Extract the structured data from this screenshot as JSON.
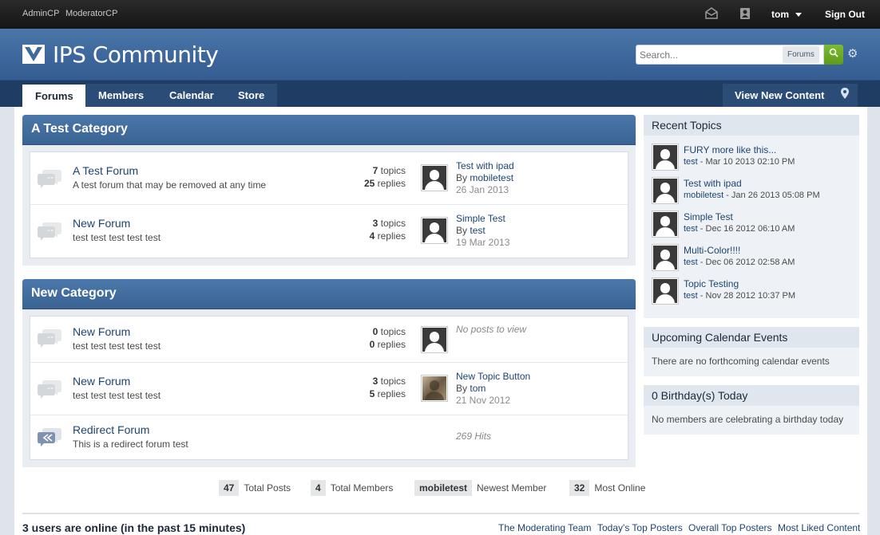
{
  "topbar": {
    "links": [
      "AdminCP",
      "ModeratorCP"
    ],
    "icons": [
      "envelope-icon",
      "contact-card-icon"
    ],
    "user": "tom",
    "signout": "Sign Out"
  },
  "header": {
    "title": "IPS Community",
    "search_placeholder": "Search...",
    "search_scope": "Forums"
  },
  "nav": {
    "tabs": [
      "Forums",
      "Members",
      "Calendar",
      "Store"
    ],
    "view_new": "View New Content"
  },
  "categories": [
    {
      "title": "A Test Category",
      "forums": [
        {
          "name": "A Test Forum",
          "desc": "A test forum that may be removed at any time",
          "topics": "7",
          "topics_label": "topics",
          "replies": "25",
          "replies_label": "replies",
          "last_title": "Test with ipad",
          "last_by_prefix": "By",
          "last_by": "mobiletest",
          "last_date": "26 Jan 2013"
        },
        {
          "name": "New Forum",
          "desc": "test test test test test",
          "topics": "3",
          "topics_label": "topics",
          "replies": "4",
          "replies_label": "replies",
          "last_title": "Simple Test",
          "last_by_prefix": "By",
          "last_by": "test",
          "last_date": "19 Mar 2013"
        }
      ]
    },
    {
      "title": "New Category",
      "forums": [
        {
          "name": "New Forum",
          "desc": "test test test test test",
          "topics": "0",
          "topics_label": "topics",
          "replies": "0",
          "replies_label": "replies",
          "no_posts": "No posts to view"
        },
        {
          "name": "New Forum",
          "desc": "test test test test test",
          "topics": "3",
          "topics_label": "topics",
          "replies": "5",
          "replies_label": "replies",
          "last_title": "New Topic Button",
          "last_by_prefix": "By",
          "last_by": "tom",
          "last_date": "21 Nov 2012"
        },
        {
          "name": "Redirect Forum",
          "desc": "This is a redirect forum test",
          "hits": "269 Hits"
        }
      ]
    }
  ],
  "sidebar": {
    "recent_title": "Recent Topics",
    "recent": [
      {
        "title": "FURY more like this...",
        "author": "test",
        "date": " - Mar 10 2013 02:10 PM"
      },
      {
        "title": "Test with ipad",
        "author": "mobiletest",
        "date": " - Jan 26 2013 05:08 PM"
      },
      {
        "title": "Simple Test",
        "author": "test",
        "date": " - Dec 16 2012 06:10 AM"
      },
      {
        "title": "Multi-Color!!!!",
        "author": "test",
        "date": " - Dec 06 2012 02:58 AM"
      },
      {
        "title": "Topic Testing",
        "author": "test",
        "date": " - Nov 28 2012 10:37 PM"
      }
    ],
    "events_title": "Upcoming Calendar Events",
    "events_text": "There are no forthcoming calendar events",
    "birthday_title": "0 Birthday(s) Today",
    "birthday_text": "No members are celebrating a birthday today"
  },
  "stats": {
    "posts": "47",
    "posts_label": "Total Posts",
    "members": "4",
    "members_label": "Total Members",
    "newest": "mobiletest",
    "newest_label": "Newest Member",
    "online_max": "32",
    "online_max_label": "Most Online"
  },
  "footer": {
    "online": "3 users are online (in the past 15 minutes)",
    "links": [
      "The Moderating Team",
      "Today's Top Posters",
      "Overall Top Posters",
      "Most Liked Content"
    ]
  }
}
